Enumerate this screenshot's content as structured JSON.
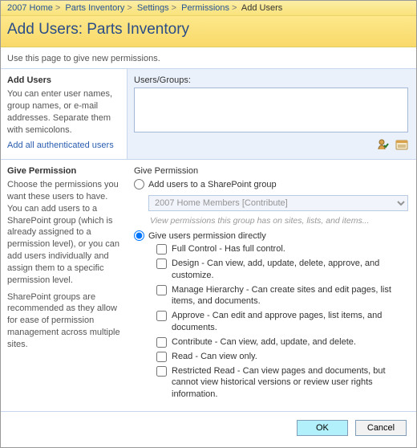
{
  "breadcrumb": {
    "items": [
      "2007 Home",
      "Parts Inventory",
      "Settings",
      "Permissions",
      "Add Users"
    ]
  },
  "title": "Add Users: Parts Inventory",
  "instruction": "Use this page to give new permissions.",
  "addUsers": {
    "heading": "Add Users",
    "desc": "You can enter user names, group names, or e-mail addresses. Separate them with semicolons.",
    "link": "Add all authenticated users",
    "fieldLabel": "Users/Groups:",
    "value": ""
  },
  "givePermission": {
    "heading": "Give Permission",
    "desc": "Choose the permissions you want these users to have. You can add users to a SharePoint group (which is already assigned to a permission level), or you can add users individually and assign them to a specific permission level.",
    "note": "SharePoint groups are recommended as they allow for ease of permission management across multiple sites.",
    "subheading": "Give Permission",
    "radio1": "Add users to a SharePoint group",
    "groupSelect": "2007 Home Members [Contribute]",
    "viewText": "View permissions this group has on sites, lists, and items...",
    "radio2": "Give users permission directly",
    "permissions": [
      "Full Control - Has full control.",
      "Design - Can view, add, update, delete, approve, and customize.",
      "Manage Hierarchy - Can create sites and edit pages, list items, and documents.",
      "Approve - Can edit and approve pages, list items, and documents.",
      "Contribute - Can view, add, update, and delete.",
      "Read - Can view only.",
      "Restricted Read - Can view pages and documents, but cannot view historical versions or review user rights information."
    ]
  },
  "buttons": {
    "ok": "OK",
    "cancel": "Cancel"
  }
}
